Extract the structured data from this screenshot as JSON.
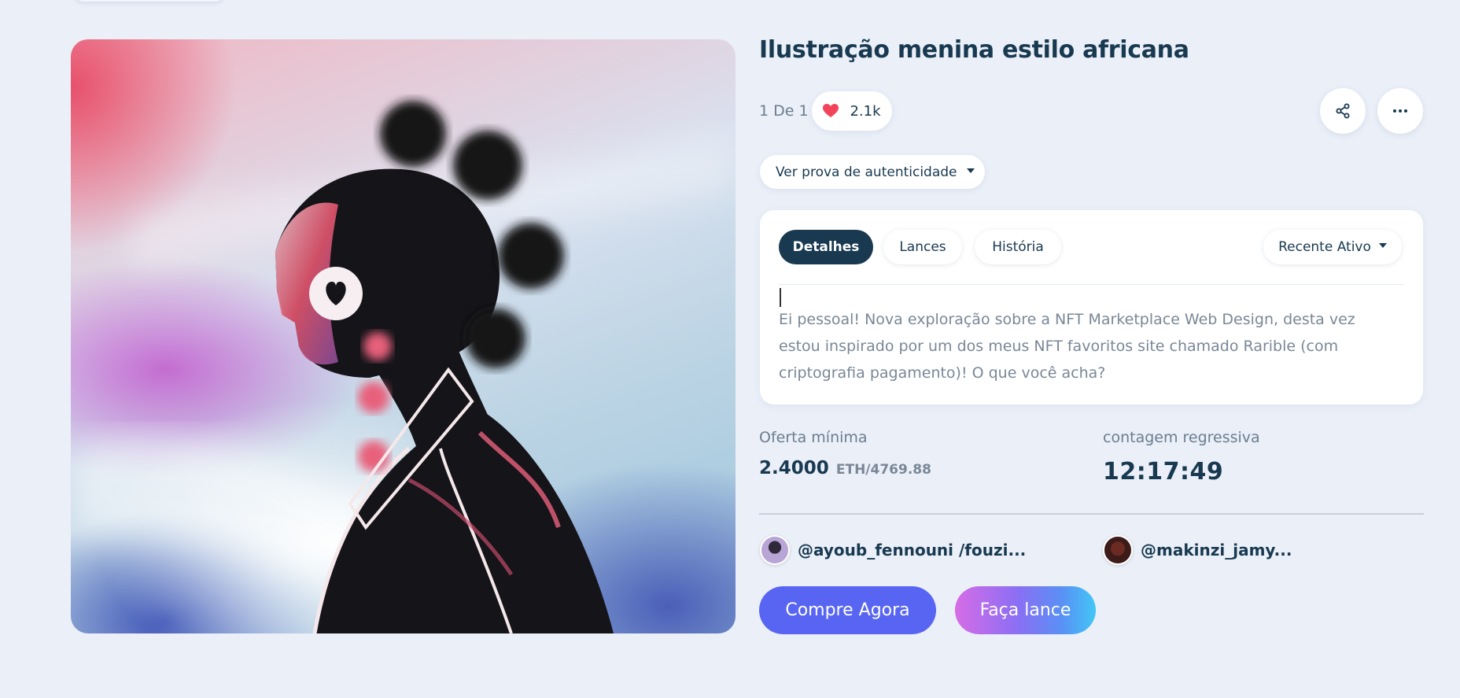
{
  "colors": {
    "primary": "#183950",
    "accent": "#5865f2",
    "like": "#f2455c",
    "background": "#eaeff8"
  },
  "artwork": {
    "alt": ""
  },
  "product": {
    "title": "Ilustração menina estilo africana",
    "edition": "1 De 1",
    "likes": "2.1k",
    "like_icon": "heart-icon",
    "share_icon": "share-icon",
    "more_icon": "more-horizontal-icon"
  },
  "proof_dropdown": {
    "label": "Ver prova de autenticidade"
  },
  "tabs": [
    {
      "label": "Detalhes",
      "active": true
    },
    {
      "label": "Lances",
      "active": false
    },
    {
      "label": "História",
      "active": false
    }
  ],
  "sort_dropdown": {
    "label": "Recente Ativo"
  },
  "description": "Ei pessoal! Nova exploração sobre a NFT Marketplace Web Design, desta vez estou inspirado por um dos meus NFT favoritos site chamado Rarible (com criptografia pagamento)! O que você acha?",
  "offer": {
    "label": "Oferta mínima",
    "value": "2.4000",
    "unit": "ETH/4769.88"
  },
  "countdown": {
    "label": "contagem regressiva",
    "value": "12:17:49"
  },
  "creators": [
    {
      "handle": "@ayoub_fennouni /fouzi..."
    },
    {
      "handle": "@makinzi_jamy..."
    }
  ],
  "actions": {
    "buy_label": "Compre Agora",
    "bid_label": "Faça lance"
  }
}
